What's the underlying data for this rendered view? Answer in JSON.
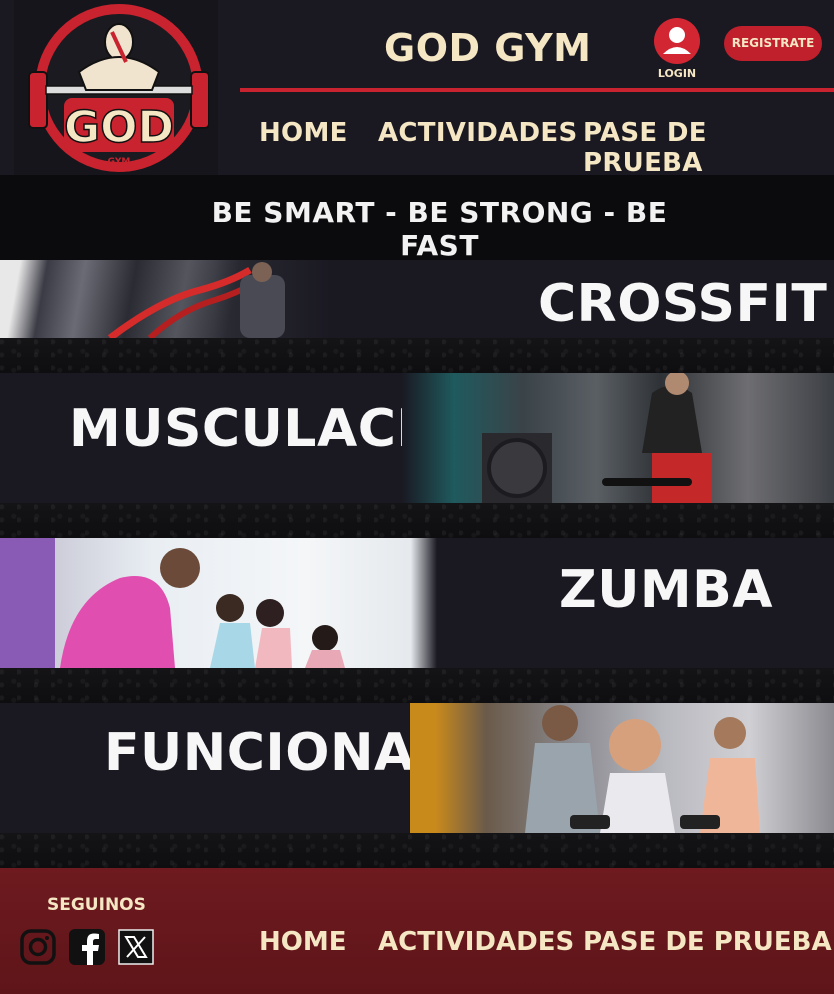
{
  "header": {
    "brand": "GOD GYM",
    "logo_text": "GOD",
    "logo_subtext": "GYM",
    "login_label": "LOGIN",
    "register_label": "REGISTRATE"
  },
  "nav": [
    {
      "label": "HOME"
    },
    {
      "label": "ACTIVIDADES"
    },
    {
      "label": "PASE DE PRUEBA"
    }
  ],
  "tagline": "BE SMART - BE STRONG - BE FAST",
  "activities": [
    {
      "title": "CROSSFIT",
      "photo": "battle-ropes-photo"
    },
    {
      "title": "MUSCULACION",
      "photo": "rowing-machine-photo"
    },
    {
      "title": "ZUMBA",
      "photo": "zumba-class-photo"
    },
    {
      "title": "FUNCIONAL",
      "photo": "dumbbell-class-photo"
    }
  ],
  "footer": {
    "follow_label": "SEGUINOS",
    "social": [
      "instagram-icon",
      "facebook-icon",
      "x-icon"
    ],
    "nav": [
      {
        "label": "HOME"
      },
      {
        "label": "ACTIVIDADES"
      },
      {
        "label": "PASE DE PRUEBA"
      }
    ]
  },
  "colors": {
    "background": "#1a1921",
    "accent_red": "#c8232e",
    "cream": "#f5e6c4",
    "footer": "#6e1a1f"
  }
}
